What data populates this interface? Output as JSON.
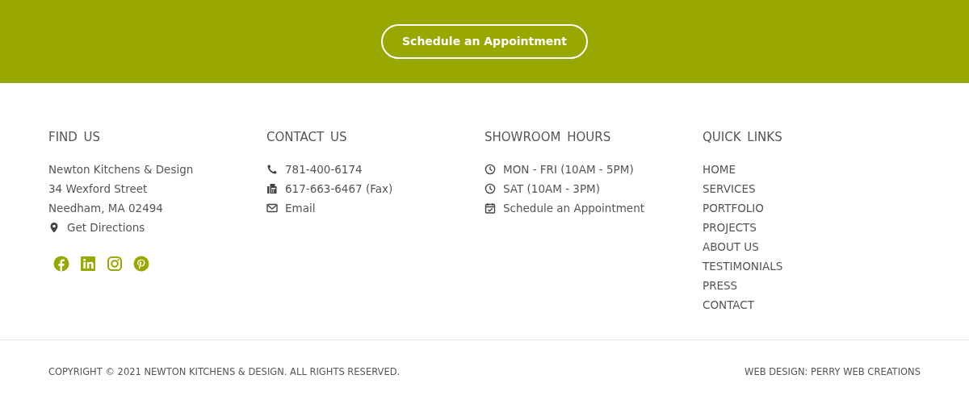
{
  "banner": {
    "button": "Schedule an Appointment"
  },
  "columns": [
    {
      "heading": "FIND US",
      "items": [
        {
          "kind": "text",
          "text": "Newton Kitchens & Design"
        },
        {
          "kind": "text",
          "text": "34 Wexford Street"
        },
        {
          "kind": "text",
          "text": "Needham, MA 02494"
        },
        {
          "kind": "pin",
          "text": "Get Directions"
        }
      ],
      "social": [
        {
          "kind": "facebook"
        },
        {
          "kind": "linkedin"
        },
        {
          "kind": "instagram"
        },
        {
          "kind": "pinterest"
        }
      ]
    },
    {
      "heading": "CONTACT US",
      "items": [
        {
          "kind": "phone",
          "text": "781-400-6174"
        },
        {
          "kind": "fax",
          "text": "617-663-6467 (Fax)"
        },
        {
          "kind": "email",
          "text": "Email"
        }
      ]
    },
    {
      "heading": "SHOWROOM HOURS",
      "items": [
        {
          "kind": "clock",
          "text": "MON - FRI (10AM - 5PM)"
        },
        {
          "kind": "clock",
          "text": "SAT (10AM - 3PM)"
        },
        {
          "kind": "calendar",
          "text": "Schedule an Appointment"
        }
      ]
    },
    {
      "heading": "QUICK LINKS",
      "items": [
        {
          "kind": "link",
          "text": "HOME"
        },
        {
          "kind": "link",
          "text": "SERVICES"
        },
        {
          "kind": "link",
          "text": "PORTFOLIO"
        },
        {
          "kind": "link",
          "text": "PROJECTS"
        },
        {
          "kind": "link",
          "text": "ABOUT US"
        },
        {
          "kind": "link",
          "text": "TESTIMONIALS"
        },
        {
          "kind": "link",
          "text": "PRESS"
        },
        {
          "kind": "link",
          "text": "CONTACT"
        }
      ]
    }
  ],
  "bottom": {
    "copyright": "COPYRIGHT © 2021 NEWTON KITCHENS & DESIGN. ALL RIGHTS RESERVED.",
    "credit": "WEB DESIGN: PERRY WEB CREATIONS"
  }
}
